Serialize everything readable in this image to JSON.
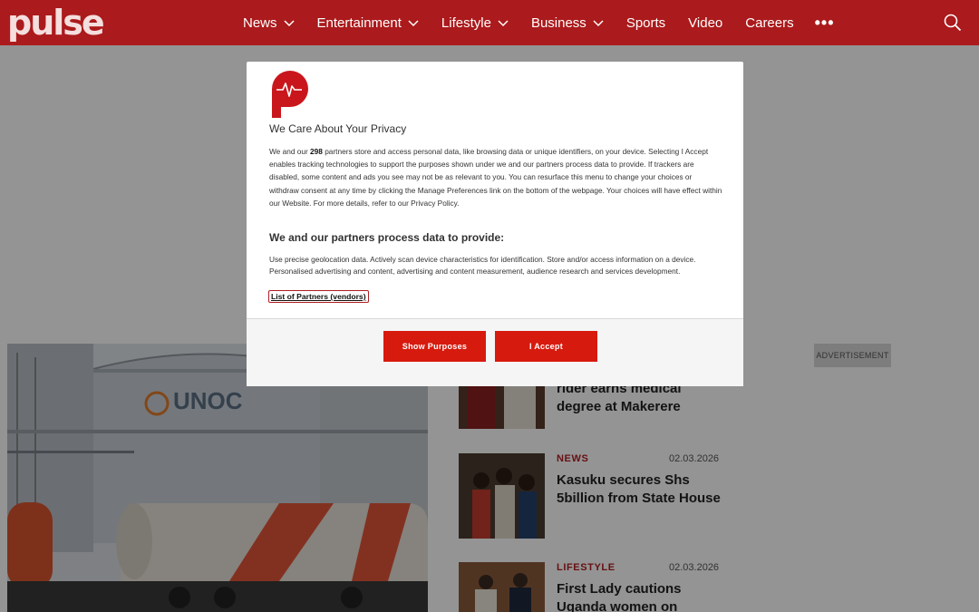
{
  "header": {
    "logo": "pulse",
    "nav": [
      {
        "label": "News",
        "dropdown": true
      },
      {
        "label": "Entertainment",
        "dropdown": true
      },
      {
        "label": "Lifestyle",
        "dropdown": true
      },
      {
        "label": "Business",
        "dropdown": true
      },
      {
        "label": "Sports",
        "dropdown": false
      },
      {
        "label": "Video",
        "dropdown": false
      },
      {
        "label": "Careers",
        "dropdown": false
      }
    ],
    "more_label": "•••",
    "search_icon": "search-icon"
  },
  "colors": {
    "brand": "#ab1a1c",
    "accent_button": "#d71a0e",
    "category": "#b01e22"
  },
  "hero": {
    "image": "UNOC fuel tanks and tanker wagon",
    "sign_text": "UNOC"
  },
  "advertisement_label": "ADVERTISEMENT",
  "stories": [
    {
      "category": "",
      "date": "",
      "title": "rider earns medical degree at Makerere"
    },
    {
      "category": "NEWS",
      "date": "02.03.2026",
      "title": "Kasuku secures Shs 5billion from State House"
    },
    {
      "category": "LIFESTYLE",
      "date": "02.03.2026",
      "title": "First Lady cautions Uganda women on"
    }
  ],
  "privacy_modal": {
    "title": "We Care About Your Privacy",
    "intro_before": "We and our ",
    "partner_count": "298",
    "intro_after": " partners store and access personal data, like browsing data or unique identifiers, on your device. Selecting I Accept enables tracking technologies to support the purposes shown under we and our partners process data to provide. If trackers are disabled, some content and ads you see may not be as relevant to you. You can resurface this menu to change your choices or withdraw consent at any time by clicking the Manage Preferences link on the bottom of the webpage. Your choices will have effect within our Website. For more details, refer to our Privacy Policy.",
    "subtitle": "We and our partners process data to provide:",
    "purposes": "Use precise geolocation data. Actively scan device characteristics for identification. Store and/or access information on a device. Personalised advertising and content, advertising and content measurement, audience research and services development.",
    "partners_link": "List of Partners (vendors)",
    "buttons": {
      "show_purposes": "Show Purposes",
      "accept": "I Accept"
    }
  }
}
